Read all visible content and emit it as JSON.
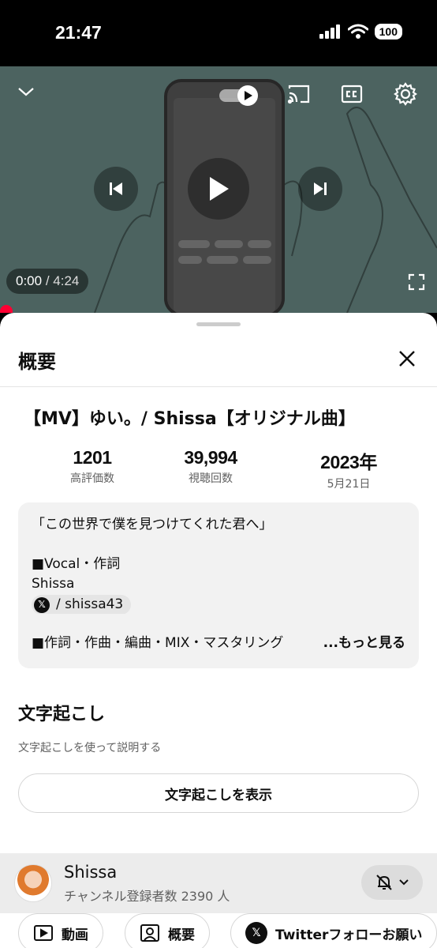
{
  "status_bar": {
    "time": "21:47",
    "battery": "100"
  },
  "player": {
    "current_time": "0:00",
    "separator": " / ",
    "duration": "4:24"
  },
  "sheet": {
    "title": "概要"
  },
  "video": {
    "title": "【MV】ゆい。/ Shissa【オリジナル曲】",
    "stats": [
      {
        "value": "1201",
        "label": "高評価数"
      },
      {
        "value": "39,994",
        "label": "視聴回数"
      },
      {
        "value": "2023年",
        "label": "5月21日"
      }
    ]
  },
  "description": {
    "line1": "「この世界で僕を見つけてくれた君へ」",
    "line2": "■Vocal・作詞",
    "line3": "Shissa",
    "chip_logo": "𝕏",
    "chip_text": "/ shissa43",
    "line4": "■作詞・作曲・編曲・MIX・マスタリング",
    "more": "...もっと見る"
  },
  "transcript": {
    "title": "文字起こし",
    "subtitle": "文字起こしを使って説明する",
    "button": "文字起こしを表示"
  },
  "channel": {
    "name": "Shissa",
    "subscribers": "チャンネル登録者数 2390 人"
  },
  "bottom_chips": [
    {
      "label": "動画"
    },
    {
      "label": "概要"
    },
    {
      "label": "Twitterフォローお願い",
      "logo": "𝕏"
    }
  ],
  "colors": {
    "accent_red": "#ff0033",
    "sheet_bg": "#ffffff",
    "desc_bg": "#f2f2f2"
  }
}
